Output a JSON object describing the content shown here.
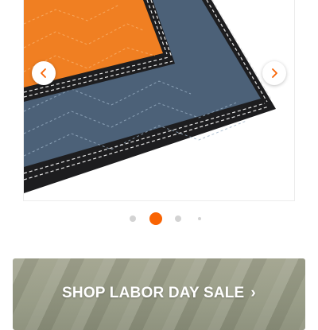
{
  "carousel": {
    "image_alt": "",
    "prev_icon": "chevron-left-icon",
    "next_icon": "chevron-right-icon",
    "accent_color": "#f96302",
    "slide_count": 4,
    "active_index": 1
  },
  "promo": {
    "label": "SHOP LABOR DAY SALE",
    "chevron": "›",
    "icon": "chevron-right-icon"
  }
}
